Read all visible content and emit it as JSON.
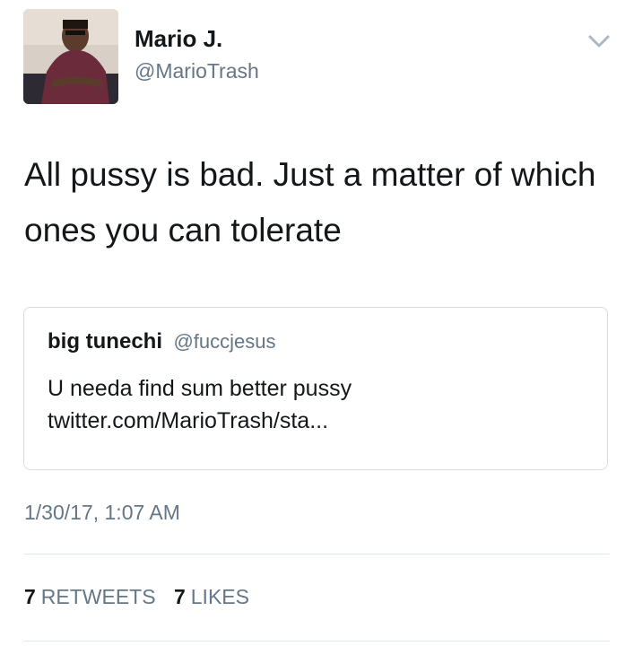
{
  "author": {
    "display_name": "Mario J.",
    "handle": "@MarioTrash"
  },
  "tweet": {
    "text": "All pussy is bad. Just a matter of which ones you can tolerate",
    "timestamp": "1/30/17, 1:07 AM"
  },
  "quoted_tweet": {
    "display_name": "big tunechi",
    "handle": "@fuccjesus",
    "text": "U needa find sum better pussy",
    "link": "twitter.com/MarioTrash/sta..."
  },
  "stats": {
    "retweets_count": "7",
    "retweets_label": "RETWEETS",
    "likes_count": "7",
    "likes_label": "LIKES"
  },
  "icons": {
    "menu": "chevron-down-icon"
  },
  "colors": {
    "text_primary": "#14171a",
    "text_secondary": "#657786",
    "border": "#d8dde2",
    "divider": "#e1e8ed"
  }
}
